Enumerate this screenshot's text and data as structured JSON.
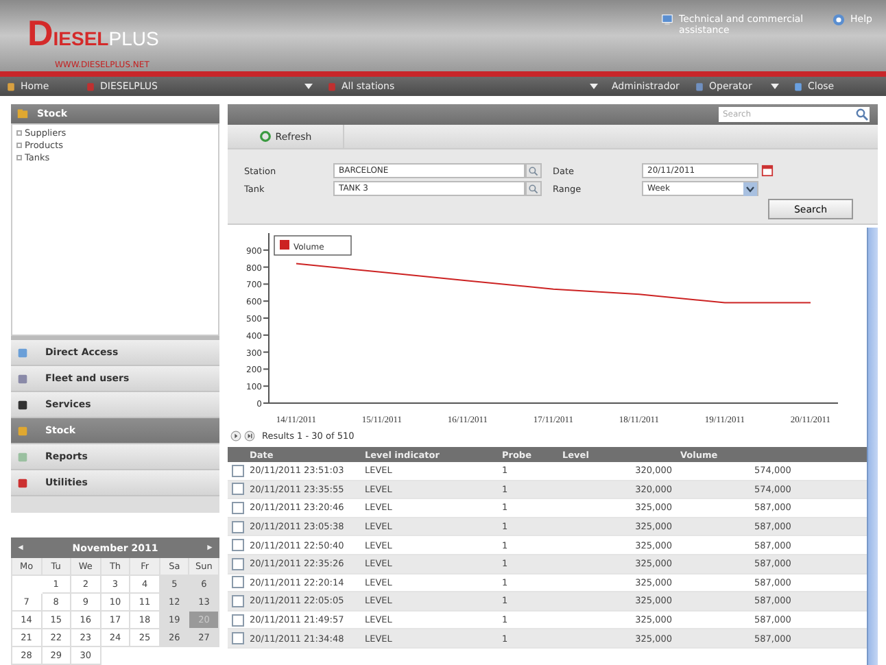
{
  "logo": {
    "parts": [
      {
        "text": "D",
        "kind": "initial"
      },
      {
        "text": "IESEL",
        "kind": "main"
      },
      {
        "text": "PLUS",
        "kind": "accent"
      }
    ],
    "url": "WWW.DIESELPLUS.NET"
  },
  "header_links": [
    {
      "label": "Technical and commercial assistance",
      "kind": "support"
    },
    {
      "label": "Help",
      "kind": "help"
    }
  ],
  "navbar": [
    {
      "label": "Home",
      "kind": "home",
      "dropdown": false
    },
    {
      "label": "DIESELPLUS",
      "kind": "company",
      "dropdown": true
    },
    {
      "label": "All stations",
      "kind": "station",
      "dropdown": true
    },
    {
      "label": "Administrador",
      "kind": "plain",
      "dropdown": false
    },
    {
      "label": "Operator",
      "kind": "user",
      "dropdown": true
    },
    {
      "label": "Close",
      "kind": "close",
      "dropdown": false
    }
  ],
  "sidebar": {
    "panel_title": "Stock",
    "tree": [
      {
        "label": "Suppliers"
      },
      {
        "label": "Products"
      },
      {
        "label": "Tanks"
      }
    ],
    "menu": [
      {
        "label": "Direct Access",
        "selected": false
      },
      {
        "label": "Fleet and users",
        "selected": false
      },
      {
        "label": "Services",
        "selected": false
      },
      {
        "label": "Stock",
        "selected": true
      },
      {
        "label": "Reports",
        "selected": false
      },
      {
        "label": "Utilities",
        "selected": false
      }
    ]
  },
  "calendar": {
    "prev": "◄",
    "title": "November 2011",
    "next": "►",
    "weekdays": [
      "Mo",
      "Tu",
      "We",
      "Th",
      "Fr",
      "Sa",
      "Sun"
    ],
    "weeks": [
      [
        {
          "day": "1",
          "selected": false
        },
        {
          "day": "2",
          "selected": false
        },
        {
          "day": "3",
          "selected": false
        },
        {
          "day": "4",
          "selected": false
        },
        {
          "day": "5",
          "selected": false
        },
        {
          "day": "6",
          "selected": false
        }
      ],
      [
        {
          "day": "7",
          "selected": false
        },
        {
          "day": "8",
          "selected": false
        },
        {
          "day": "9",
          "selected": false
        },
        {
          "day": "10",
          "selected": false
        },
        {
          "day": "11",
          "selected": false
        },
        {
          "day": "12",
          "selected": false
        },
        {
          "day": "13",
          "selected": false
        }
      ],
      [
        {
          "day": "14",
          "selected": false
        },
        {
          "day": "15",
          "selected": false
        },
        {
          "day": "16",
          "selected": false
        },
        {
          "day": "17",
          "selected": false
        },
        {
          "day": "18",
          "selected": false
        },
        {
          "day": "19",
          "selected": false
        },
        {
          "day": "20",
          "selected": true
        }
      ],
      [
        {
          "day": "21",
          "selected": false
        },
        {
          "day": "22",
          "selected": false
        },
        {
          "day": "23",
          "selected": false
        },
        {
          "day": "24",
          "selected": false
        },
        {
          "day": "25",
          "selected": false
        },
        {
          "day": "26",
          "selected": false
        },
        {
          "day": "27",
          "selected": false
        }
      ],
      [
        {
          "day": "28",
          "selected": false
        },
        {
          "day": "29",
          "selected": false
        },
        {
          "day": "30",
          "selected": false
        }
      ]
    ]
  },
  "search": {
    "placeholder": "Search"
  },
  "toolbar": {
    "refresh": "Refresh"
  },
  "form": {
    "station_label": "Station",
    "station": "BARCELONE",
    "tank_label": "Tank",
    "tank": "TANK 3",
    "date_label": "Date",
    "date": "20/11/2011",
    "range_label": "Range",
    "range": "Week",
    "search_button": "Search"
  },
  "chart_data": {
    "type": "line",
    "categories": [
      "14/11/2011",
      "15/11/2011",
      "16/11/2011",
      "17/11/2011",
      "18/11/2011",
      "19/11/2011",
      "20/11/2011"
    ],
    "ylim": [
      0,
      1000
    ],
    "yticks": [
      0,
      100,
      200,
      300,
      400,
      500,
      600,
      700,
      800,
      900
    ],
    "series": [
      {
        "name": "Volume",
        "color": "#cc2222",
        "values": [
          820,
          770,
          720,
          670,
          640,
          590,
          590
        ]
      }
    ]
  },
  "results": {
    "text": "Results 1 - 30 of 510"
  },
  "table": {
    "columns": [
      "Date",
      "Level indicator",
      "Probe",
      "Level",
      "Volume"
    ],
    "rows": [
      {
        "cells": [
          "20/11/2011 23:51:03",
          "LEVEL",
          "1",
          "320,000",
          "574,000"
        ],
        "checked": false
      },
      {
        "cells": [
          "20/11/2011 23:35:55",
          "LEVEL",
          "1",
          "320,000",
          "574,000"
        ],
        "checked": false
      },
      {
        "cells": [
          "20/11/2011 23:20:46",
          "LEVEL",
          "1",
          "325,000",
          "587,000"
        ],
        "checked": false
      },
      {
        "cells": [
          "20/11/2011 23:05:38",
          "LEVEL",
          "1",
          "325,000",
          "587,000"
        ],
        "checked": false
      },
      {
        "cells": [
          "20/11/2011 22:50:40",
          "LEVEL",
          "1",
          "325,000",
          "587,000"
        ],
        "checked": false
      },
      {
        "cells": [
          "20/11/2011 22:35:26",
          "LEVEL",
          "1",
          "325,000",
          "587,000"
        ],
        "checked": false
      },
      {
        "cells": [
          "20/11/2011 22:20:14",
          "LEVEL",
          "1",
          "325,000",
          "587,000"
        ],
        "checked": false
      },
      {
        "cells": [
          "20/11/2011 22:05:05",
          "LEVEL",
          "1",
          "325,000",
          "587,000"
        ],
        "checked": false
      },
      {
        "cells": [
          "20/11/2011 21:49:57",
          "LEVEL",
          "1",
          "325,000",
          "587,000"
        ],
        "checked": false
      },
      {
        "cells": [
          "20/11/2011 21:34:48",
          "LEVEL",
          "1",
          "325,000",
          "587,000"
        ],
        "checked": false
      }
    ]
  }
}
